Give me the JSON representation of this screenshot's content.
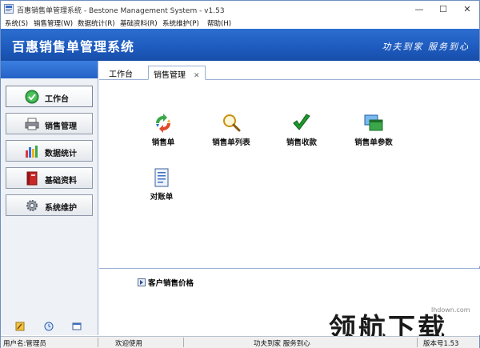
{
  "window": {
    "title": "百惠销售单管理系统 - Bestone Management System - v1.53",
    "controls": {
      "minimize": "—",
      "maximize": "☐",
      "close": "✕"
    }
  },
  "menu": {
    "items": [
      {
        "label": "系统(S)"
      },
      {
        "label": "销售管理(W)"
      },
      {
        "label": "数据统计(R)"
      },
      {
        "label": "基础资料(R)"
      },
      {
        "label": "系统维护(P)"
      },
      {
        "label": "帮助(H)"
      }
    ]
  },
  "banner": {
    "title": "百惠销售单管理系统",
    "slogan": "功夫到家 服务到心"
  },
  "sidebar": {
    "items": [
      {
        "label": "工作台",
        "icon": "check-circle-icon"
      },
      {
        "label": "销售管理",
        "icon": "printer-icon"
      },
      {
        "label": "数据统计",
        "icon": "bar-chart-icon"
      },
      {
        "label": "基础资料",
        "icon": "book-icon"
      },
      {
        "label": "系统维护",
        "icon": "gear-icon"
      }
    ],
    "bottom_icons": [
      "edit-icon",
      "clock-icon",
      "window-icon"
    ]
  },
  "tabs": [
    {
      "label": "工作台"
    },
    {
      "label": "销售管理",
      "close": "✕"
    }
  ],
  "functions": [
    {
      "label": "销售单",
      "icon": "recycle-arrows-icon"
    },
    {
      "label": "销售单列表",
      "icon": "magnifier-icon"
    },
    {
      "label": "销售收款",
      "icon": "checkmark-icon"
    },
    {
      "label": "销售单参数",
      "icon": "windows-stack-icon"
    },
    {
      "label": "对账单",
      "icon": "document-icon"
    }
  ],
  "lower": {
    "item": "客户销售价格"
  },
  "status": {
    "user": "用户名:管理员",
    "welcome": "欢迎使用",
    "slogan": "功夫到家 服务到心",
    "version": "版本号1.53"
  },
  "watermark": {
    "text": "领航下载",
    "url": "lhdown.com"
  }
}
